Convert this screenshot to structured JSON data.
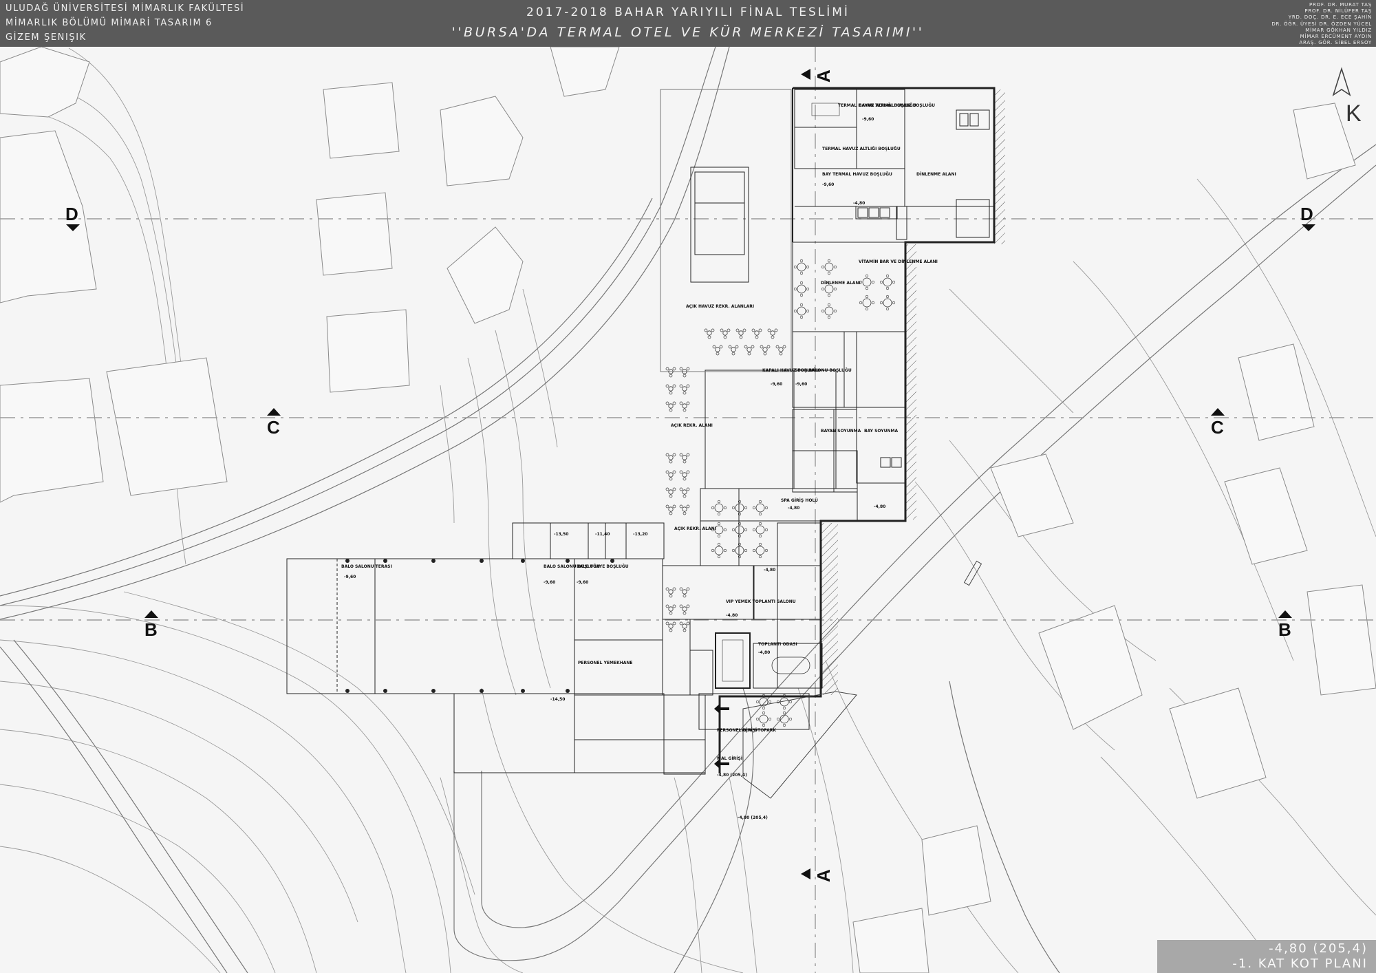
{
  "header": {
    "school_lines": [
      "ULUDAĞ ÜNİVERSİTESİ MİMARLIK FAKÜLTESİ",
      "MİMARLIK BÖLÜMÜ MİMARİ TASARIM 6",
      "GİZEM ŞENIŞIK"
    ],
    "title": "2017-2018 BAHAR YARIYILI FİNAL TESLİMİ",
    "subtitle": "''BURSA'DA TERMAL OTEL VE  KÜR MERKEZİ TASARIMI''",
    "instructors": [
      "PROF. DR. MURAT TAŞ",
      "PROF. DR. NİLÜFER TAŞ",
      "YRD. DOÇ. DR. E. ECE ŞAHİN",
      "DR. ÖĞR. ÜYESİ DR. ÖZDEN YÜCEL",
      "MİMAR GÖKHAN YILDIZ",
      "MİMAR ERCÜMENT AYDIN",
      "ARAŞ. GÖR. SİBEL ERSOY"
    ]
  },
  "north_arrow": {
    "label": "K"
  },
  "section_markers": {
    "a": "A",
    "b": "B",
    "c": "C",
    "d": "D"
  },
  "room_labels": {
    "termal_havuz_1": "TERMAL HAVUZ ALTLIĞI BOŞLUĞU",
    "bayan_termal": "BAYAN TERMAL HAVUZ BOŞLUĞU",
    "termal_havuz_2": "TERMAL HAVUZ ALTLIĞI BOŞLUĞU",
    "bay_termal": "BAY TERMAL HAVUZ BOŞLUĞU",
    "dinlenme_alani": "DİNLENME ALANI",
    "vitamin_bar": "VİTAMİN BAR VE DİNLENME ALANI",
    "dinlenme_alani_2": "DİNLENME ALANI",
    "acik_havuz": "AÇIK HAVUZ REKR. ALANLARI",
    "kapali_havuz": "KAPALI HAVUZ BOŞLUĞU",
    "spor_baloni": "SPOR BALONU BOŞLUĞU",
    "acik_rekr_1": "AÇIK REKR. ALANI",
    "acik_rekr_2": "AÇIK REKR. ALANI",
    "spa_giris": "SPA GİRİŞ HOLÜ",
    "bayan_soyunma": "BAYAN SOYUNMA",
    "bay_soyunma": "BAY SOYUNMA",
    "balo_terasi": "BALO SALONU TERASI",
    "balo_boslugu": "BALO SALONU BOŞLUĞU",
    "balo_fuaye": "BALO FUAYE BOŞLUĞU",
    "vip_yemek": "VIP YEMEK TOPLANTI SALONU",
    "toplanti_odasi": "TOPLANTI ODASI",
    "personel_girisi": "PERSONEL GİRİŞİ",
    "acik_otopark": "AÇIK OTOPARK",
    "mal_girisi": "MAL GİRİŞİ",
    "personel_yemekhane": "PERSONEL YEMEKHANE"
  },
  "elevations": {
    "e960": "-9,60",
    "e480": "-4,80",
    "e1140": "-11,40",
    "e1350": "-13,50",
    "e1450": "-14,50",
    "e1320": "-13,20",
    "e480_alt": "-4,80 (205,4)",
    "e480_road": "-4,80 (205,4)"
  },
  "level": {
    "elevation": "-4,80 (205,4)",
    "name": "-1. KAT KOT PLANI"
  }
}
